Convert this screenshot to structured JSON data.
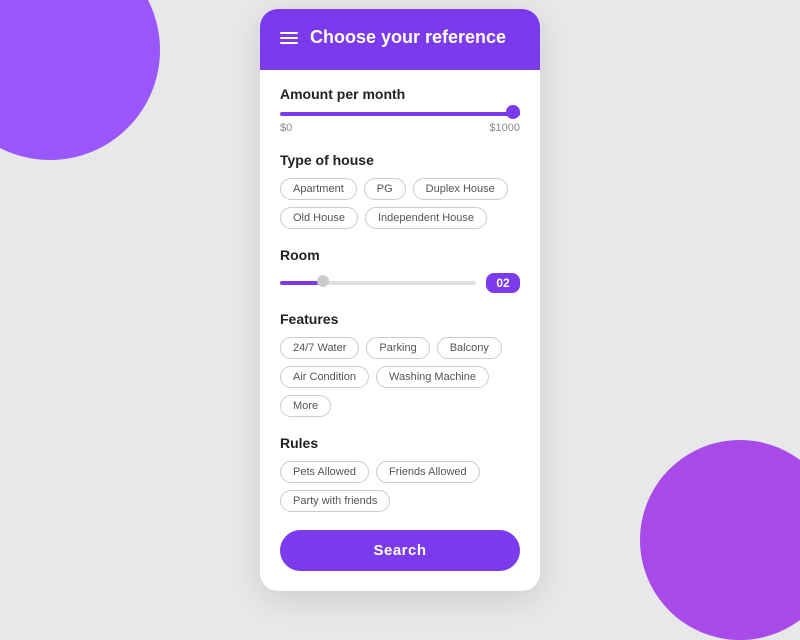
{
  "background": {
    "color": "#e8e8e8",
    "blob_color_1": "#8b3dff",
    "blob_color_2": "#9c2ee8"
  },
  "header": {
    "title": "Choose your reference",
    "hamburger_label": "menu"
  },
  "amount_section": {
    "title": "Amount per month",
    "min_label": "$0",
    "max_label": "$1000",
    "value": 1000
  },
  "house_type_section": {
    "title": "Type of house",
    "options": [
      {
        "label": "Apartment"
      },
      {
        "label": "PG"
      },
      {
        "label": "Duplex House"
      },
      {
        "label": "Old House"
      },
      {
        "label": "Independent House"
      }
    ]
  },
  "room_section": {
    "title": "Room",
    "value": "02",
    "slider_value": 20
  },
  "features_section": {
    "title": "Features",
    "options": [
      {
        "label": "24/7 Water"
      },
      {
        "label": "Parking"
      },
      {
        "label": "Balcony"
      },
      {
        "label": "Air Condition"
      },
      {
        "label": "Washing Machine"
      },
      {
        "label": "More"
      }
    ]
  },
  "rules_section": {
    "title": "Rules",
    "options": [
      {
        "label": "Pets Allowed"
      },
      {
        "label": "Friends Allowed"
      },
      {
        "label": "Party with friends"
      }
    ]
  },
  "search_button": {
    "label": "Search"
  }
}
